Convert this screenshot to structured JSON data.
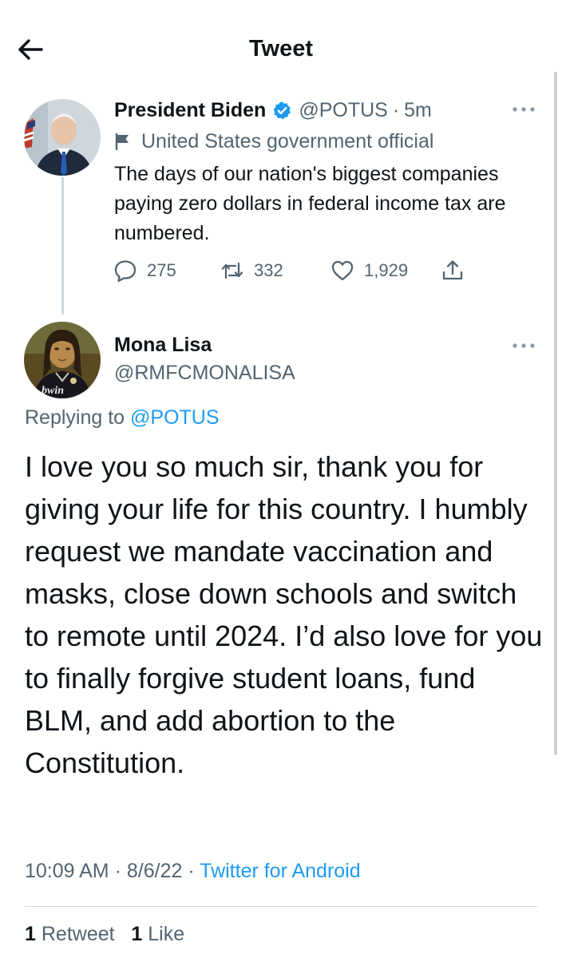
{
  "header": {
    "title": "Tweet",
    "back_icon": "arrow-left-icon"
  },
  "parent_tweet": {
    "display_name": "President Biden",
    "handle": "@POTUS",
    "separator": "·",
    "time": "5m",
    "label": "United States government official",
    "text": "The days of our nation's biggest companies paying zero dollars in federal income tax are numbered.",
    "replies": "275",
    "retweets": "332",
    "likes": "1,929",
    "verified_color": "#1d9bf0"
  },
  "reply_tweet": {
    "display_name": "Mona Lisa",
    "handle": "@RMFCMONALISA",
    "replying_prefix": "Replying to",
    "replying_handle": "@POTUS",
    "text": "I love you so much sir, thank you for giving your life for this country. I humbly request we mandate vaccination and masks, close down schools and switch to remote until 2024. I’d also love for you to finally forgive student loans, fund BLM, and add abortion to the Constitution.",
    "avatar_text": "bwin",
    "meta": {
      "time": "10:09 AM",
      "date": "8/6/22",
      "separator": "·",
      "source": "Twitter for Android"
    },
    "stats": {
      "retweets_count": "1",
      "retweets_label": "Retweet",
      "likes_count": "1",
      "likes_label": "Like"
    }
  },
  "colors": {
    "link": "#1d9bf0",
    "secondary_text": "#536471",
    "primary_text": "#0f1419",
    "divider": "#cfd9de"
  }
}
